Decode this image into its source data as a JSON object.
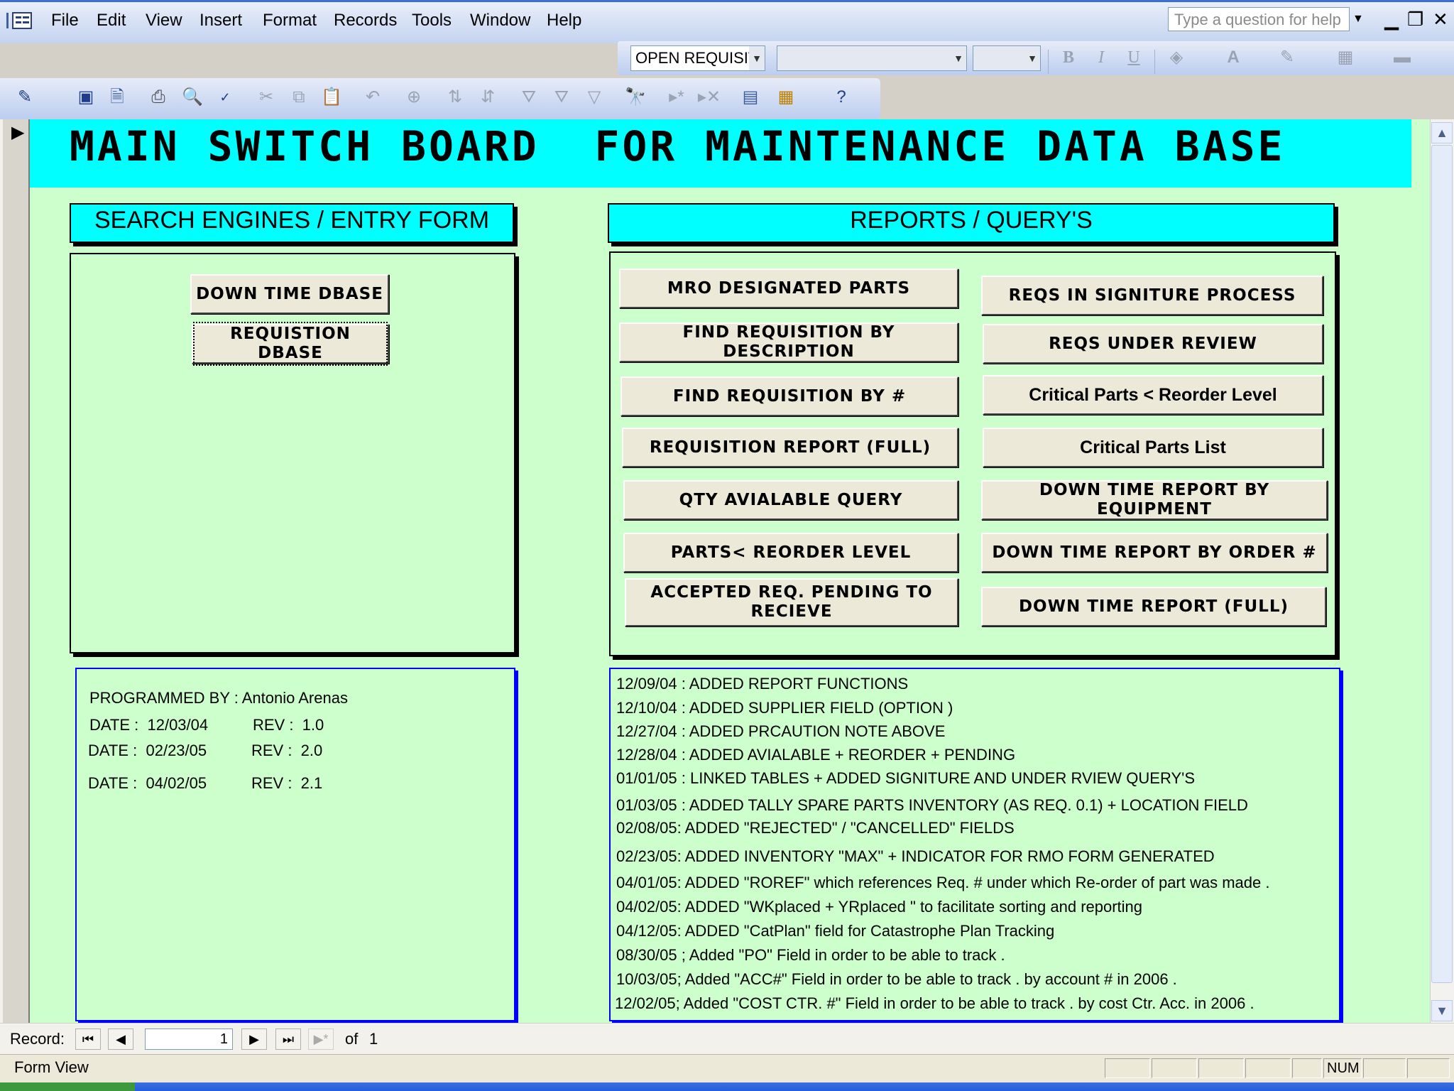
{
  "menubar": {
    "items": [
      "File",
      "Edit",
      "View",
      "Insert",
      "Format",
      "Records",
      "Tools",
      "Window",
      "Help"
    ],
    "help_placeholder": "Type a question for help"
  },
  "toolbar": {
    "object_combo": "OPEN REQUISIT",
    "font_combo": "",
    "size_combo": "",
    "format_icons": [
      "bold-icon",
      "italic-icon",
      "underline-icon",
      "fill-color-icon",
      "font-color-icon",
      "line-color-icon",
      "borders-icon",
      "line-style-icon"
    ],
    "standard_icons": [
      "design-view-icon",
      "save-icon",
      "file-search-icon",
      "print-icon",
      "print-preview-icon",
      "spelling-icon",
      "cut-icon",
      "copy-icon",
      "paste-icon",
      "undo-icon",
      "hyperlink-icon",
      "sort-ascending-icon",
      "sort-descending-icon",
      "filter-by-selection-icon",
      "filter-by-form-icon",
      "apply-filter-icon",
      "find-icon",
      "new-record-icon",
      "delete-record-icon",
      "database-window-icon",
      "new-object-icon",
      "help-icon"
    ],
    "bold": "B",
    "italic": "I",
    "underline": "U"
  },
  "form": {
    "title": "MAIN SWITCH BOARD  FOR MAINTENANCE DATA BASE",
    "search_heading": "SEARCH ENGINES / ENTRY FORM",
    "reports_heading": "REPORTS / QUERY'S",
    "search_buttons": [
      "DOWN TIME DBASE",
      "REQUISTION DBASE"
    ],
    "report_buttons_left": [
      "MRO DESIGNATED PARTS",
      "FIND REQUISITION BY DESCRIPTION",
      "FIND REQUISITION BY  #",
      "REQUISITION REPORT (FULL)",
      "QTY AVIALABLE QUERY",
      "PARTS< REORDER LEVEL",
      "ACCEPTED REQ. PENDING TO RECIEVE"
    ],
    "report_buttons_right": [
      "REQS IN SIGNITURE PROCESS",
      "REQS UNDER REVIEW",
      "Critical Parts < Reorder Level",
      "Critical Parts List",
      "DOWN TIME REPORT BY EQUIPMENT",
      "DOWN TIME REPORT BY ORDER #",
      "DOWN TIME REPORT (FULL)"
    ],
    "programmed_by": "PROGRAMMED BY : Antonio Arenas",
    "revisions": [
      {
        "date": "DATE :  12/03/04",
        "rev": "REV :  1.0"
      },
      {
        "date": "DATE :  02/23/05",
        "rev": "REV :  2.0"
      },
      {
        "date": "DATE :  04/02/05",
        "rev": "REV :  2.1"
      }
    ],
    "change_log": [
      "12/09/04 : ADDED REPORT FUNCTIONS",
      "12/10/04 : ADDED SUPPLIER FIELD (OPTION )",
      "12/27/04 : ADDED PRCAUTION NOTE ABOVE",
      "12/28/04 : ADDED AVIALABLE + REORDER  + PENDING",
      "01/01/05 : LINKED TABLES + ADDED SIGNITURE  AND UNDER RVIEW QUERY'S",
      "01/03/05 : ADDED TALLY SPARE PARTS INVENTORY (AS REQ. 0.1) + LOCATION FIELD",
      "02/08/05: ADDED \"REJECTED\" / \"CANCELLED\" FIELDS",
      "02/23/05: ADDED INVENTORY \"MAX\" + INDICATOR FOR RMO FORM GENERATED",
      "04/01/05: ADDED \"ROREF\" which references Req. # under which Re-order of part was made .",
      "04/02/05: ADDED \"WKplaced + YRplaced \" to facilitate sorting and reporting",
      "04/12/05: ADDED \"CatPlan\" field for Catastrophe Plan Tracking",
      "08/30/05 ; Added \"PO\" Field in order to be able to track .",
      "10/03/05; Added \"ACC#\" Field in order to be able to track . by account # in 2006 .",
      "12/02/05; Added \"COST CTR. #\" Field in order to be able to track . by cost Ctr. Acc. in 2006 ."
    ]
  },
  "navigator": {
    "label": "Record:",
    "current": "1",
    "of_label": "of",
    "total": "1"
  },
  "status": {
    "view": "Form View",
    "num": "NUM"
  },
  "colors": {
    "form_bg": "#ccffcc",
    "banner": "#00ffff",
    "info_border": "#0000ff"
  }
}
